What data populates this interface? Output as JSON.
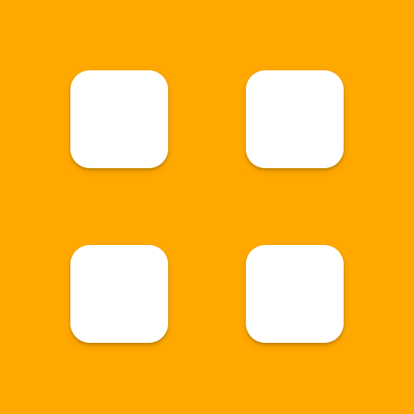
{
  "icon": {
    "name": "app-grid-icon",
    "background_color": "#FFA800",
    "tile_color": "#FFFFFF",
    "tiles": [
      {
        "name": "tile-top-left"
      },
      {
        "name": "tile-top-right"
      },
      {
        "name": "tile-bottom-left"
      },
      {
        "name": "tile-bottom-right"
      }
    ]
  }
}
